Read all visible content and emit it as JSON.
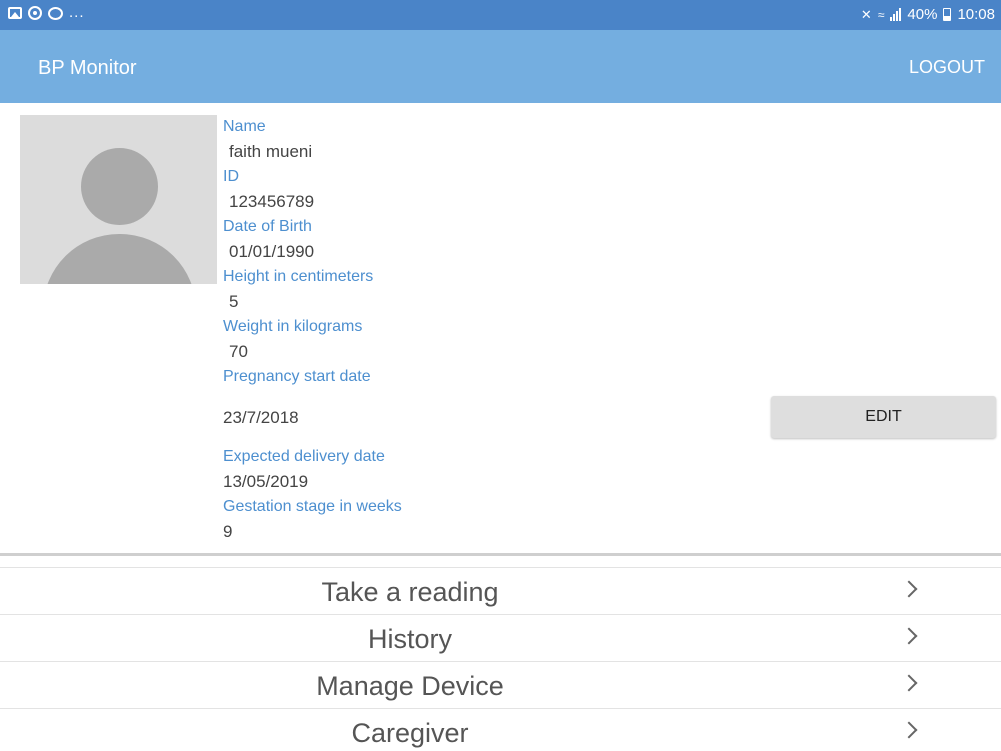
{
  "status_bar": {
    "left_more": "...",
    "battery_percent": "40%",
    "time": "10:08",
    "icons": [
      "image-icon",
      "chrome-icon",
      "chat-icon",
      "mute-icon",
      "wifi-icon",
      "signal-icon",
      "battery-icon"
    ]
  },
  "app_bar": {
    "title": "BP Monitor",
    "logout_label": "LOGOUT"
  },
  "profile": {
    "avatar_icon": "person-placeholder-icon",
    "name_label": "Name",
    "name_value": "faith mueni",
    "id_label": "ID",
    "id_value": "123456789",
    "dob_label": "Date of Birth",
    "dob_value": "01/01/1990",
    "height_label": "Height in centimeters",
    "height_value": "5",
    "weight_label": "Weight in kilograms",
    "weight_value": "70",
    "pregnancy_start_label": "Pregnancy start date",
    "pregnancy_start_value": "23/7/2018",
    "expected_delivery_label": "Expected delivery date",
    "expected_delivery_value": "13/05/2019",
    "gestation_label": "Gestation stage in weeks",
    "gestation_value": "9"
  },
  "edit_label": "EDIT",
  "menu": {
    "items": [
      {
        "label": "Take a reading"
      },
      {
        "label": "History"
      },
      {
        "label": "Manage Device"
      },
      {
        "label": "Caregiver"
      }
    ]
  },
  "colors": {
    "status_bar": "#4a84c8",
    "app_bar": "#74aee0",
    "label_blue": "#4d8fcf"
  }
}
